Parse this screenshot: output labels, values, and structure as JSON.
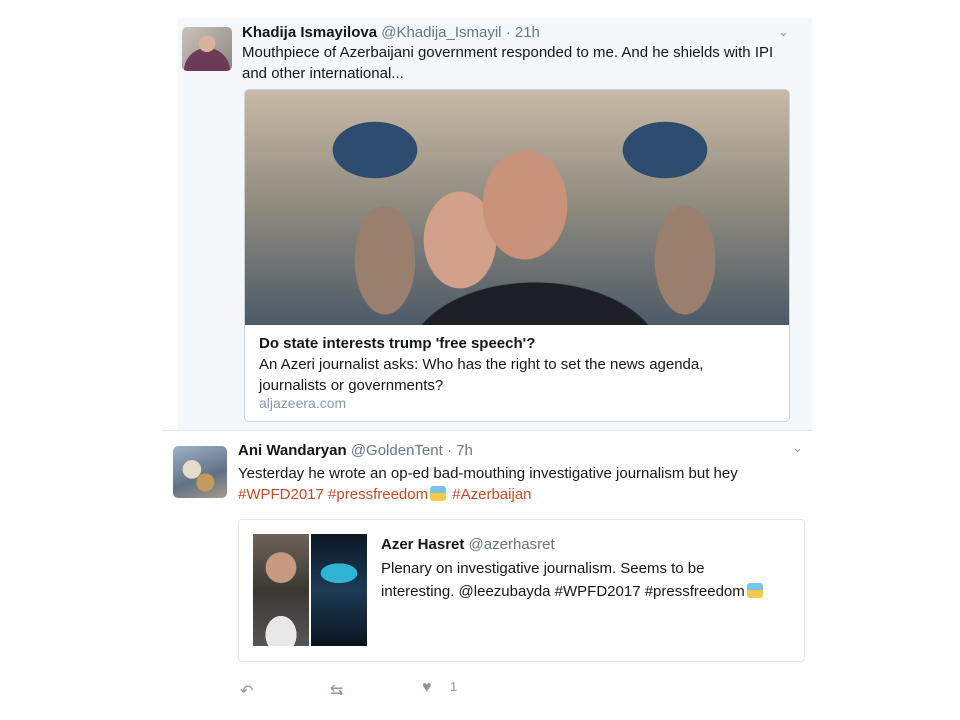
{
  "tweets": [
    {
      "name": "Khadija Ismayilova",
      "handle": "@Khadija_Ismayil",
      "time": "21h",
      "text": "Mouthpiece of Azerbaijani government responded to me. And he shields with IPI and other international...",
      "card": {
        "title": "Do state interests trump 'free speech'?",
        "description": "An Azeri journalist asks: Who has the right to set the news agenda, journalists or governments?",
        "domain": "aljazeera.com"
      }
    },
    {
      "name": "Ani Wandaryan",
      "handle": "@GoldenTent",
      "time": "7h",
      "text": "Yesterday he wrote an op-ed bad-mouthing investigative journalism but hey",
      "hashtags": [
        "#WPFD2017",
        "#pressfreedom",
        "#Azerbaijan"
      ],
      "quoted": {
        "name": "Azer Hasret",
        "handle": "@azerhasret",
        "text_line1": "Plenary on investigative journalism. Seems to be",
        "text_line2": "interesting. @leezubayda #WPFD2017 #pressfreedom"
      },
      "actions": {
        "reply_icon": "reply-icon",
        "retweet_icon": "retweet-icon",
        "like_icon": "heart-icon",
        "like_count": "1"
      }
    }
  ],
  "separator": "·",
  "colors": {
    "link": "#c34c28",
    "muted": "#657786",
    "panel": "#f5f8fa"
  }
}
